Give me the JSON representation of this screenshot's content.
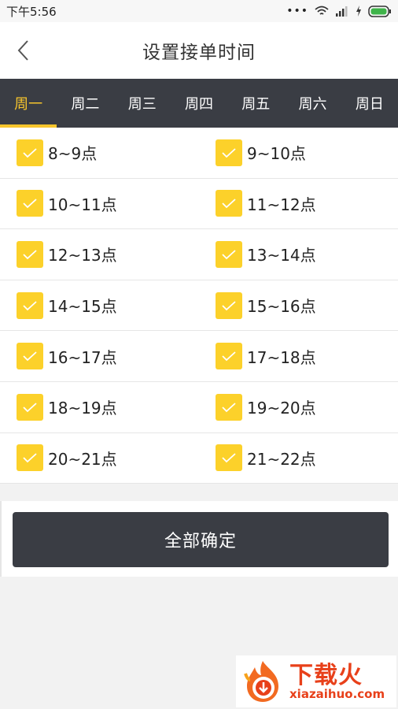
{
  "status_bar": {
    "time": "下午5:56",
    "dots": "•••"
  },
  "header": {
    "title": "设置接单时间"
  },
  "tabs": [
    {
      "label": "周一",
      "active": true
    },
    {
      "label": "周二",
      "active": false
    },
    {
      "label": "周三",
      "active": false
    },
    {
      "label": "周四",
      "active": false
    },
    {
      "label": "周五",
      "active": false
    },
    {
      "label": "周六",
      "active": false
    },
    {
      "label": "周日",
      "active": false
    }
  ],
  "slots": [
    {
      "label": "8~9点",
      "checked": true
    },
    {
      "label": "9~10点",
      "checked": true
    },
    {
      "label": "10~11点",
      "checked": true
    },
    {
      "label": "11~12点",
      "checked": true
    },
    {
      "label": "12~13点",
      "checked": true
    },
    {
      "label": "13~14点",
      "checked": true
    },
    {
      "label": "14~15点",
      "checked": true
    },
    {
      "label": "15~16点",
      "checked": true
    },
    {
      "label": "16~17点",
      "checked": true
    },
    {
      "label": "17~18点",
      "checked": true
    },
    {
      "label": "18~19点",
      "checked": true
    },
    {
      "label": "19~20点",
      "checked": true
    },
    {
      "label": "20~21点",
      "checked": true
    },
    {
      "label": "21~22点",
      "checked": true
    }
  ],
  "confirm_button": {
    "label": "全部确定"
  },
  "watermark": {
    "main": "下载火",
    "sub": "xiazaihuo.com"
  },
  "colors": {
    "accent": "#fcd12a",
    "tab_bar": "#3a3d44",
    "active_tab_text": "#f7c52c",
    "watermark": "#e8401a"
  },
  "icons": {
    "back": "chevron-left-icon",
    "check": "check-icon",
    "wifi": "wifi-icon",
    "signal": "signal-icon",
    "battery": "battery-icon",
    "charging": "charging-icon"
  }
}
